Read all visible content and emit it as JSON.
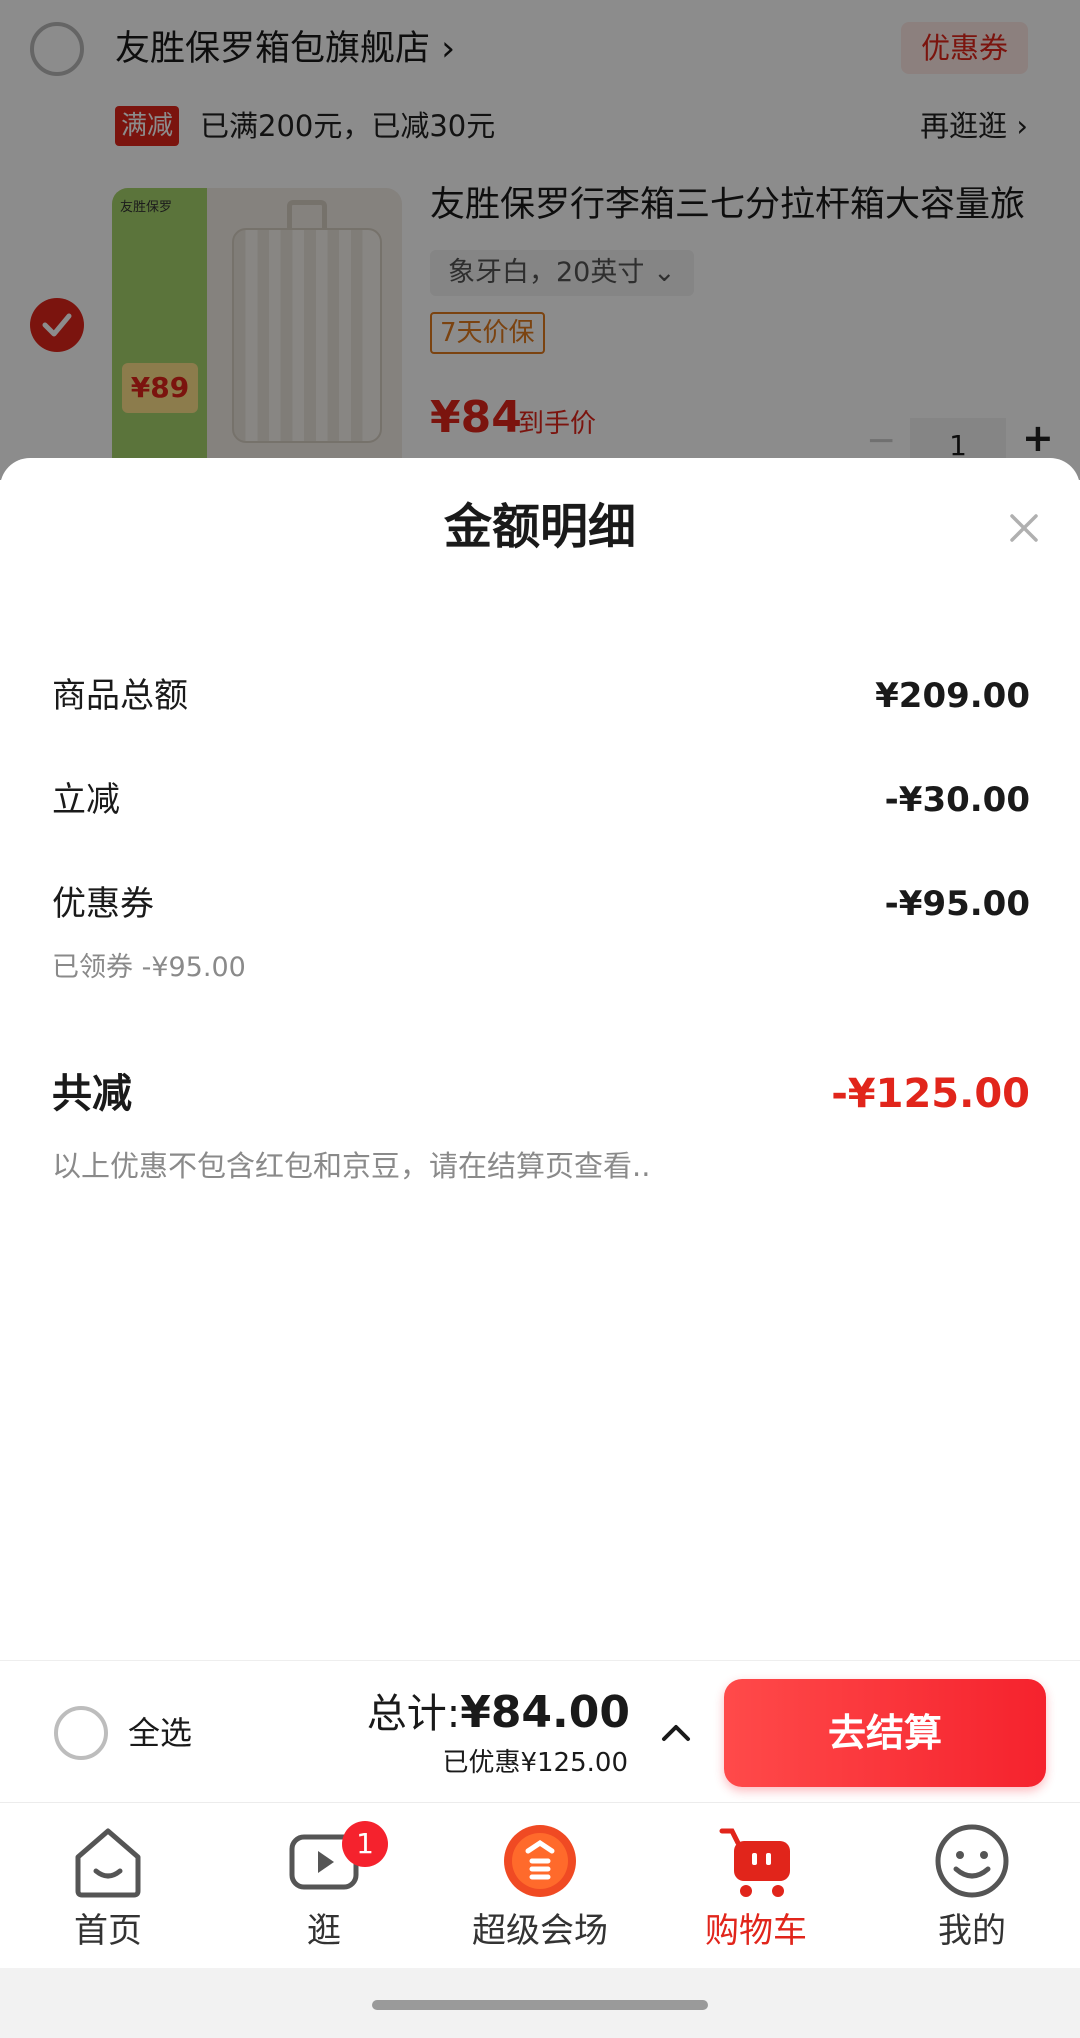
{
  "background": {
    "shop_name": "友胜保罗箱包旗舰店 ›",
    "coupon_tag": "优惠券",
    "promo_badge": "满减",
    "promo_text": "已满200元，已减30元",
    "browse_link": "再逛逛 ›",
    "item": {
      "thumb_logo": "友胜保罗",
      "thumb_price": "¥89",
      "title": "友胜保罗行李箱三七分拉杆箱大容量旅",
      "spec": "象牙白，20英寸 ⌄",
      "price_protect": "7天价保",
      "deal_price": "¥84",
      "deal_label": "到手价",
      "quantity": "1",
      "minus": "−",
      "plus": "+"
    }
  },
  "sheet": {
    "title": "金额明细",
    "rows": [
      {
        "label": "商品总额",
        "value": "¥209.00"
      },
      {
        "label": "立减",
        "value": "-¥30.00"
      },
      {
        "label": "优惠券",
        "value": "-¥95.00"
      }
    ],
    "coupon_note": "已领券 -¥95.00",
    "total": {
      "label": "共减",
      "value": "-¥125.00"
    },
    "disclaimer": "以上优惠不包含红包和京豆，请在结算页查看.."
  },
  "checkout": {
    "select_all": "全选",
    "total_prefix": "总计:",
    "total_amount": "¥84.00",
    "saved": "已优惠¥125.00",
    "button": "去结算"
  },
  "tabs": [
    {
      "label": "首页",
      "icon": "home-icon"
    },
    {
      "label": "逛",
      "icon": "video-icon",
      "badge": "1"
    },
    {
      "label": "超级会场",
      "icon": "super-venue-icon"
    },
    {
      "label": "购物车",
      "icon": "cart-icon",
      "active": true
    },
    {
      "label": "我的",
      "icon": "profile-icon"
    }
  ],
  "colors": {
    "accent": "#e1251b",
    "checkout_button": "#f5222d",
    "secondary_text": "#8a8a8a"
  }
}
